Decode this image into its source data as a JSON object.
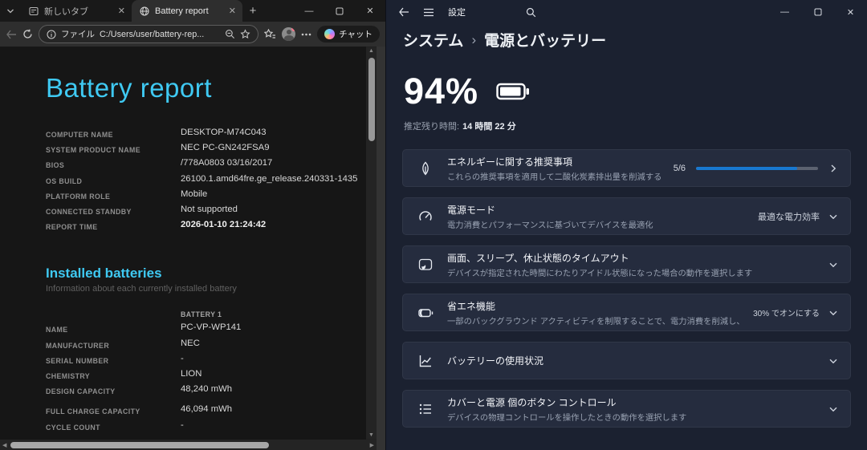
{
  "browser": {
    "tabs": [
      {
        "label": "新しいタブ",
        "icon": "new-tab-page-icon",
        "active": false
      },
      {
        "label": "Battery report",
        "icon": "globe-icon",
        "active": true
      }
    ],
    "address_bar": {
      "scheme_label": "ファイル",
      "url": "C:/Users/user/battery-rep..."
    },
    "copilot_button_label": "チャット",
    "report_page": {
      "title": "Battery report",
      "info_rows": [
        {
          "label": "COMPUTER NAME",
          "value": "DESKTOP-M74C043"
        },
        {
          "label": "SYSTEM PRODUCT NAME",
          "value": "NEC PC-GN242FSA9"
        },
        {
          "label": "BIOS",
          "value": "/778A0803 03/16/2017"
        },
        {
          "label": "OS BUILD",
          "value": "26100.1.amd64fre.ge_release.240331-1435"
        },
        {
          "label": "PLATFORM ROLE",
          "value": "Mobile"
        },
        {
          "label": "CONNECTED STANDBY",
          "value": "Not supported"
        },
        {
          "label": "REPORT TIME",
          "value": "2026-01-10 21:24:42",
          "strong": true
        }
      ],
      "installed_batteries": {
        "title": "Installed batteries",
        "subtitle": "Information about each currently installed battery",
        "column_header": "BATTERY 1",
        "rows": [
          {
            "label": "NAME",
            "value": "PC-VP-WP141"
          },
          {
            "label": "MANUFACTURER",
            "value": "NEC"
          },
          {
            "label": "SERIAL NUMBER",
            "value": "-"
          },
          {
            "label": "CHEMISTRY",
            "value": "LION"
          },
          {
            "label": "DESIGN CAPACITY",
            "value": "48,240 mWh"
          },
          {
            "label": "FULL CHARGE CAPACITY",
            "value": "46,094 mWh",
            "group_break": true
          },
          {
            "label": "CYCLE COUNT",
            "value": "-"
          }
        ]
      }
    }
  },
  "settings": {
    "app_title": "設定",
    "breadcrumb": {
      "parent": "システム",
      "separator": "›",
      "current": "電源とバッテリー"
    },
    "battery_status": {
      "percent": "94%",
      "remaining_label": "推定残り時間:",
      "remaining_value": "14 時間 22 分"
    },
    "cards": [
      {
        "name": "energy-recommendations",
        "icon": "leaf-icon",
        "title": "エネルギーに関する推奨事項",
        "subtitle": "これらの推奨事項を適用して二酸化炭素排出量を削減する",
        "progress_label": "5/6",
        "progress_fraction": 0.83,
        "chevron": "right"
      },
      {
        "name": "power-mode",
        "icon": "power-mode-icon",
        "title": "電源モード",
        "subtitle": "電力消費とパフォーマンスに基づいてデバイスを最適化",
        "value": "最適な電力効率",
        "chevron": "down"
      },
      {
        "name": "screen-sleep-timeouts",
        "icon": "screen-sleep-icon",
        "title": "画面、スリープ、休止状態のタイムアウト",
        "subtitle": "デバイスが指定された時間にわたりアイドル状態になった場合の動作を選択します",
        "chevron": "down"
      },
      {
        "name": "energy-saver",
        "icon": "battery-saver-icon",
        "title": "省エネ機能",
        "subtitle": "一部のバックグラウンド アクティビティを制限することで、電力消費を削減し、バッテリーの寿命を延ばす",
        "value": "30% でオンにする",
        "value_small": true,
        "chevron": "down"
      },
      {
        "name": "battery-usage",
        "icon": "battery-usage-icon",
        "title": "バッテリーの使用状況",
        "chevron": "down"
      },
      {
        "name": "lid-power-button-controls",
        "icon": "lid-power-controls-icon",
        "title": "カバーと電源 個のボタン コントロール",
        "subtitle": "デバイスの物理コントロールを操作したときの動作を選択します",
        "chevron": "down"
      }
    ]
  },
  "colors": {
    "accent_blue": "#1878d0",
    "report_cyan": "#3fc9f2"
  }
}
